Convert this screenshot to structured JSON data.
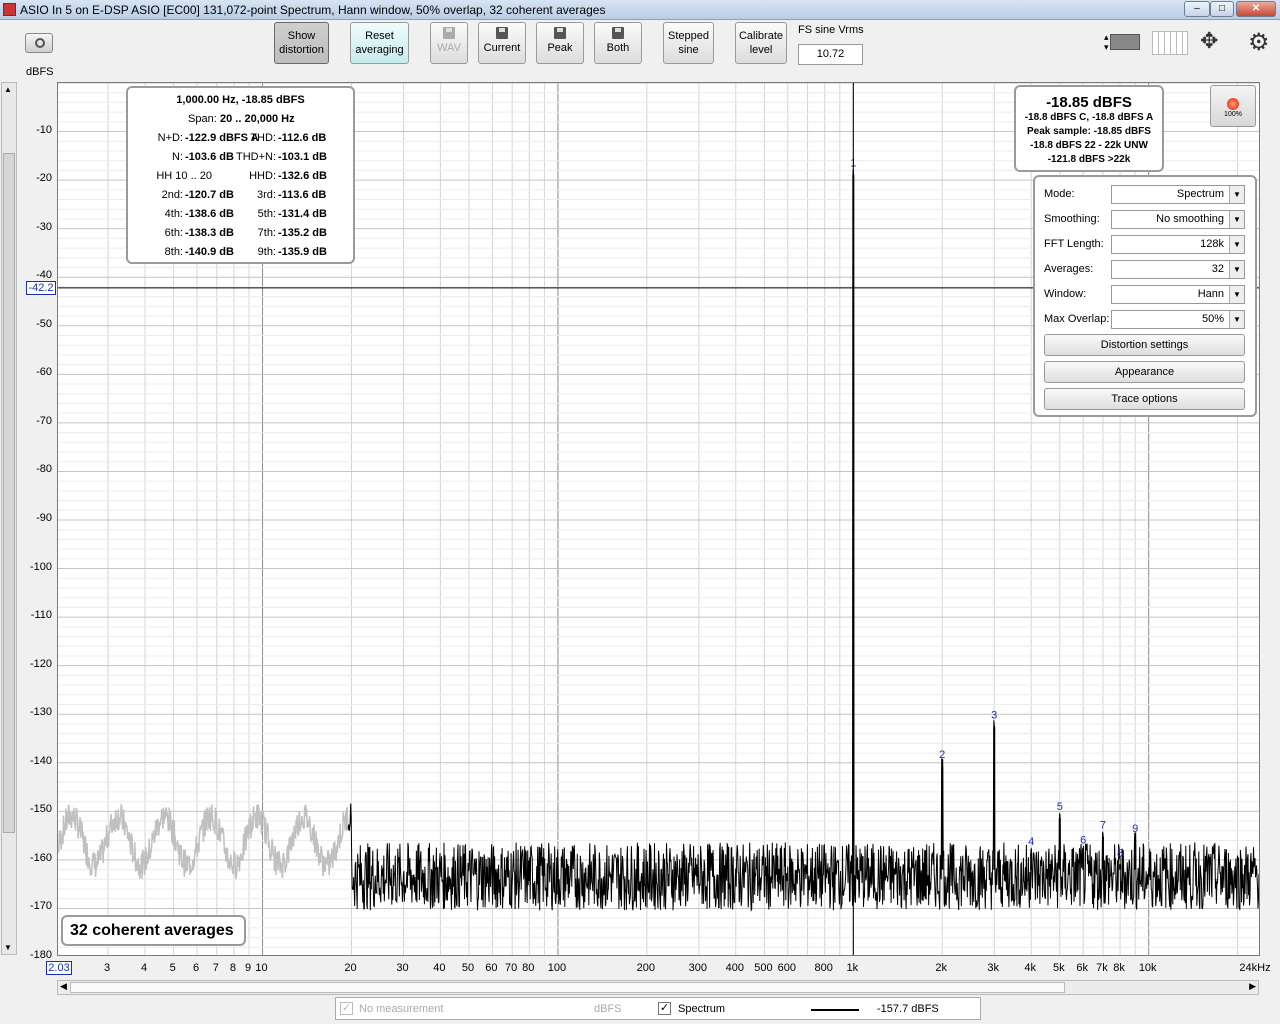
{
  "window": {
    "title": "ASIO In 5 on E-DSP ASIO [EC00] 131,072-point Spectrum, Hann window, 50% overlap, 32 coherent averages",
    "min": "–",
    "max": "□",
    "close": "✕"
  },
  "toolbar": {
    "show_distortion": [
      "Show",
      "distortion"
    ],
    "reset_averaging": [
      "Reset",
      "averaging"
    ],
    "wav": "WAV",
    "current": "Current",
    "peak": "Peak",
    "both": "Both",
    "stepped_sine": [
      "Stepped",
      "sine"
    ],
    "calibrate_level": [
      "Calibrate",
      "level"
    ],
    "fs_label": "FS sine Vrms",
    "fs_value": "10.72"
  },
  "plot": {
    "y_unit": "dBFS",
    "cursor_value": "-42.2",
    "x_start_label": "2.03",
    "y_ticks": [
      "-10",
      "-20",
      "-30",
      "-40",
      "-50",
      "-60",
      "-70",
      "-80",
      "-90",
      "-100",
      "-110",
      "-120",
      "-130",
      "-140",
      "-150",
      "-160",
      "-170",
      "-180"
    ],
    "x_ticks": [
      "3",
      "4",
      "5",
      "6",
      "7",
      "8",
      "9",
      "10",
      "20",
      "30",
      "40",
      "50",
      "60",
      "70",
      "80",
      "100",
      "200",
      "300",
      "400",
      "500",
      "600",
      "800",
      "1k",
      "2k",
      "3k",
      "4k",
      "5k",
      "6k",
      "7k",
      "8k",
      "10k",
      "24kHz"
    ]
  },
  "chart_data": {
    "type": "line",
    "xscale": "log",
    "xlim": [
      2.03,
      24000
    ],
    "ylim": [
      -180,
      0
    ],
    "ylabel": "dBFS",
    "harmonics": [
      {
        "label": "1",
        "freq": 1000,
        "level": -18.85
      },
      {
        "label": "2",
        "freq": 2000,
        "level": -140.7
      },
      {
        "label": "3",
        "freq": 3000,
        "level": -132.5
      },
      {
        "label": "4",
        "freq": 4000,
        "level": -158.6
      },
      {
        "label": "5",
        "freq": 5000,
        "level": -151.4
      },
      {
        "label": "6",
        "freq": 6000,
        "level": -158.3
      },
      {
        "label": "7",
        "freq": 7000,
        "level": -155.2
      },
      {
        "label": "8",
        "freq": 8000,
        "level": -160.9
      },
      {
        "label": "9",
        "freq": 9000,
        "level": -155.9
      }
    ],
    "noise_floor": -162
  },
  "distortion": {
    "header": "1,000.00 Hz, -18.85 dBFS",
    "span_label": "Span:",
    "span_value": "20 .. 20,000 Hz",
    "rows": [
      [
        "N+D:",
        "-122.9 dBFS A",
        "THD:",
        "-112.6 dB"
      ],
      [
        "N:",
        "-103.6 dB",
        "THD+N:",
        "-103.1 dB"
      ],
      [
        "HH 10 .. 20",
        "",
        "HHD:",
        "-132.6 dB"
      ],
      [
        "2nd:",
        "-120.7 dB",
        "3rd:",
        "-113.6 dB"
      ],
      [
        "4th:",
        "-138.6 dB",
        "5th:",
        "-131.4 dB"
      ],
      [
        "6th:",
        "-138.3 dB",
        "7th:",
        "-135.2 dB"
      ],
      [
        "8th:",
        "-140.9 dB",
        "9th:",
        "-135.9 dB"
      ]
    ]
  },
  "level": {
    "main": "-18.85 dBFS",
    "lines": [
      "-18.8 dBFS C, -18.8 dBFS A",
      "Peak sample: -18.85 dBFS",
      "-18.8 dBFS 22 - 22k UNW",
      "-121.8 dBFS >22k"
    ],
    "record_pct": "100%"
  },
  "controls": {
    "mode": {
      "label": "Mode:",
      "value": "Spectrum"
    },
    "smoothing": {
      "label": "Smoothing:",
      "value": "No  smoothing"
    },
    "fft": {
      "label": "FFT Length:",
      "value": "128k"
    },
    "averages": {
      "label": "Averages:",
      "value": "32"
    },
    "window": {
      "label": "Window:",
      "value": "Hann"
    },
    "overlap": {
      "label": "Max Overlap:",
      "value": "50%"
    },
    "distortion_settings": "Distortion settings",
    "appearance": "Appearance",
    "trace_options": "Trace options"
  },
  "avg_label": "32 coherent averages",
  "legend": {
    "no_measurement": "No measurement",
    "unit": "dBFS",
    "spectrum": "Spectrum",
    "spectrum_value": "-157.7 dBFS"
  },
  "colors": {
    "harmonic_label": "#1a2fb0",
    "cursor_box": "#1a2fb0",
    "trace": "#000000",
    "trace_low": "#c0c0c0"
  }
}
